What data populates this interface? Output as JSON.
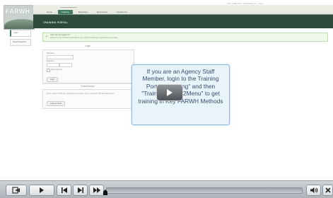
{
  "top_right_text": "YOU ARE NOT LOGGED IN. Login",
  "logo": {
    "text": "FARWH"
  },
  "nav": {
    "items": [
      "Home",
      "Training",
      "Reporting",
      "Documents",
      "Contact Us"
    ]
  },
  "portal_title": "TRAINING PORTAL",
  "sidebar": {
    "items": [
      "Login",
      "Reset Password"
    ]
  },
  "notice": {
    "title": "Help: Are you logged in?",
    "body": "Welcome to the Training Portal. Please log in with the details your supervisor has provided."
  },
  "login": {
    "heading": "Login",
    "username_label": "Username",
    "password_label": "Password",
    "remember_label": "Remember me",
    "button_label": "Login"
  },
  "guest": {
    "heading": "Guest Access",
    "text": "Some courses of this site may allow guest access. Log in as a guest with the button below.",
    "button_label": "Login as Guest"
  },
  "callout": {
    "text": "If you are an Agency Staff Member, login to the Training Portal. \"Training\" and then \"Training \"Jump2Menu\" to get training in Key FARWH Methods"
  },
  "player": {
    "progress": 0,
    "icons": [
      "exit-icon",
      "play-icon",
      "skip-start-icon",
      "skip-end-icon",
      "fast-forward-icon",
      "volume-icon",
      "close-icon"
    ]
  }
}
